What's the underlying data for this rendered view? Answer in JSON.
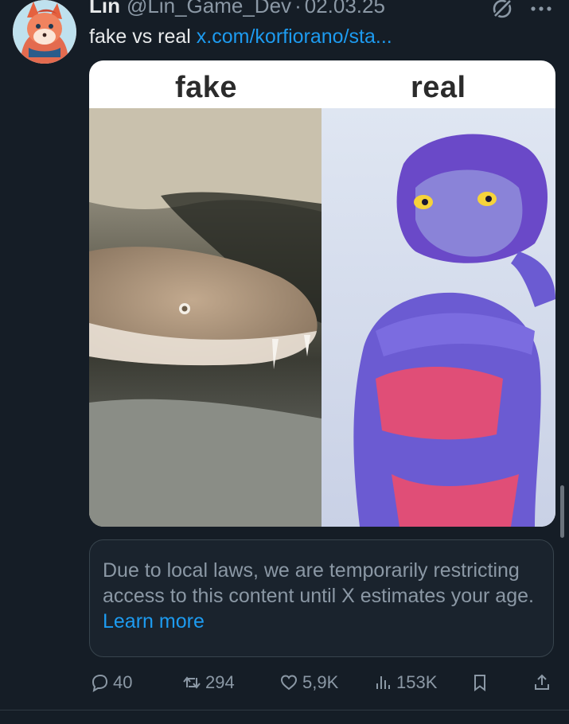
{
  "post": {
    "author_name": "Lin",
    "author_handle": "@Lin_Game_Dev",
    "separator": "·",
    "date": "02.03.25",
    "text": "fake vs real",
    "link_text": "x.com/korfiorano/sta...",
    "avatar_icon": "fox-avatar",
    "grok_icon": "grok-icon",
    "more_icon": "more-icon"
  },
  "media": {
    "left_label": "fake",
    "right_label": "real"
  },
  "notice": {
    "text": "Due to local laws, we are temporarily restricting access to this content until X estimates your age.",
    "link": "Learn more"
  },
  "actions": {
    "replies": "40",
    "reposts": "294",
    "likes": "5,9K",
    "views": "153K"
  },
  "colors": {
    "background": "#151d26",
    "accent": "#1d9bf0",
    "muted": "#8b98a5",
    "text": "#e7e9ea"
  }
}
